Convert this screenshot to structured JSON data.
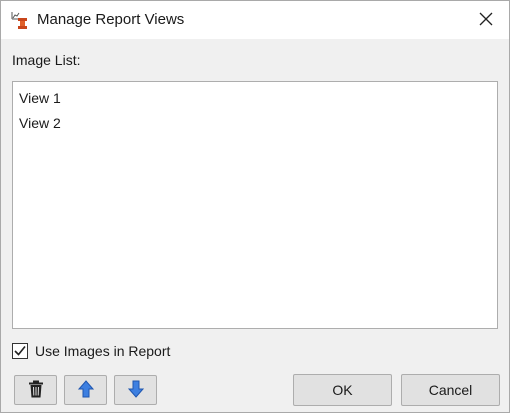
{
  "window": {
    "title": "Manage Report Views",
    "app_icon": "report-views-icon",
    "close_icon": "close-icon"
  },
  "image_list": {
    "label": "Image List:",
    "items": [
      "View 1",
      "View 2"
    ]
  },
  "use_images": {
    "label": "Use Images in Report",
    "checked": true
  },
  "toolbar": {
    "delete_icon": "trash-icon",
    "move_up_icon": "arrow-up-icon",
    "move_down_icon": "arrow-down-icon"
  },
  "buttons": {
    "ok_label": "OK",
    "cancel_label": "Cancel"
  },
  "colors": {
    "arrow_blue": "#3d7fe0",
    "title_bg": "#ffffff",
    "dialog_bg": "#f0f0f0"
  }
}
